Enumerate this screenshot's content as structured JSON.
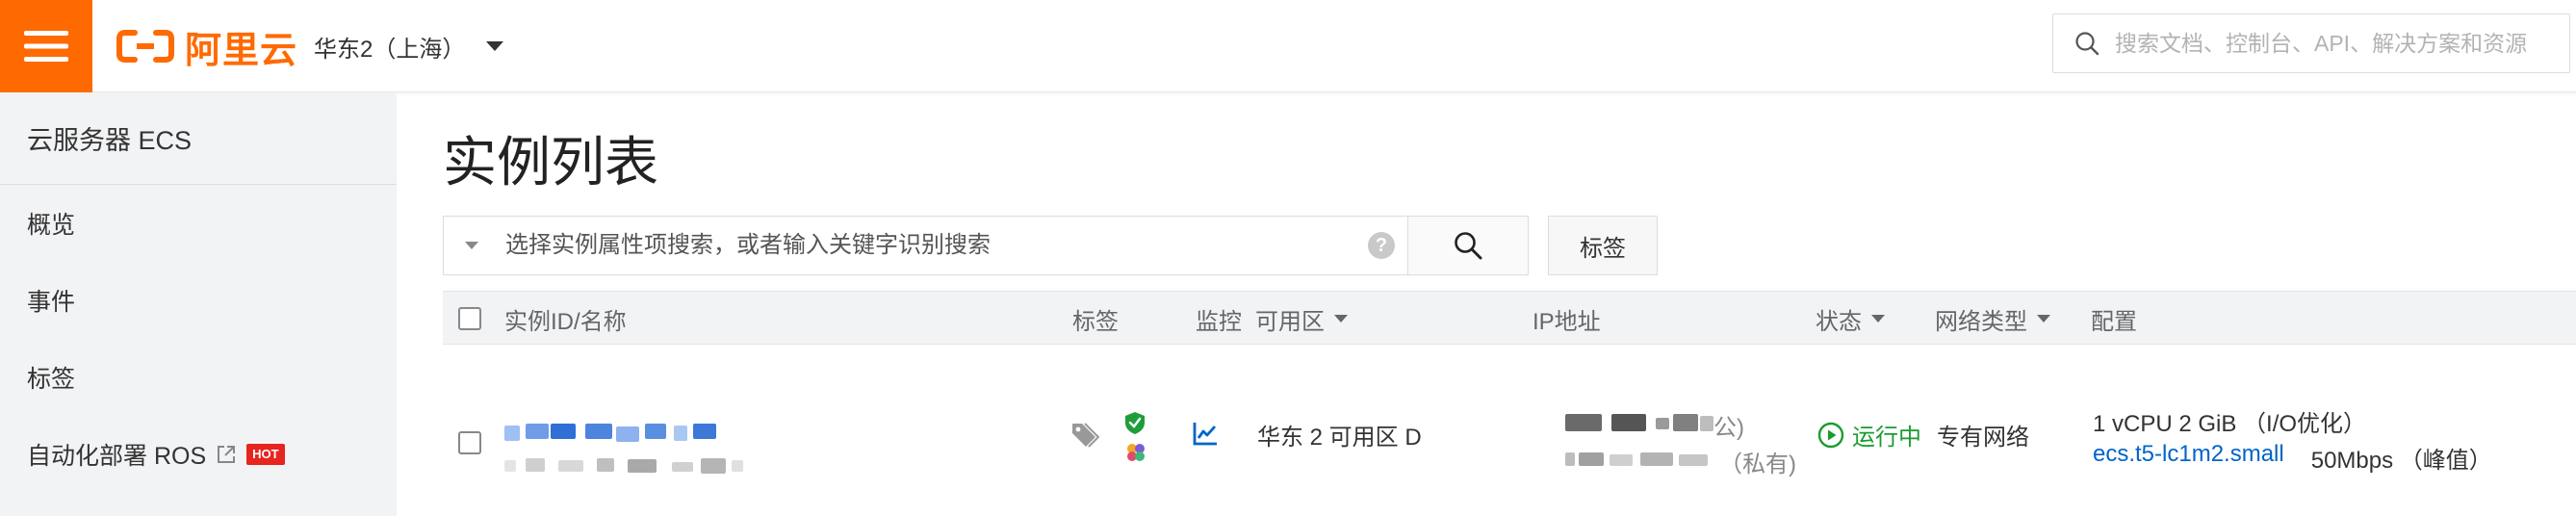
{
  "topbar": {
    "logo_text": "阿里云",
    "region": "华东2（上海）",
    "search_placeholder": "搜索文档、控制台、API、解决方案和资源"
  },
  "sidebar": {
    "title": "云服务器 ECS",
    "items": [
      {
        "label": "概览"
      },
      {
        "label": "事件"
      },
      {
        "label": "标签"
      },
      {
        "label": "自动化部署 ROS",
        "badge": "HOT"
      }
    ]
  },
  "main": {
    "title": "实例列表",
    "filter_placeholder": "选择实例属性项搜索，或者输入关键字识别搜索",
    "help": "?",
    "tag_button": "标签",
    "columns": {
      "id_name": "实例ID/名称",
      "tags": "标签",
      "monitor": "监控",
      "zone": "可用区",
      "ip": "IP地址",
      "status": "状态",
      "network": "网络类型",
      "config": "配置"
    },
    "row": {
      "zone": "华东 2 可用区 D",
      "ip_public_suffix": "公)",
      "ip_private_suffix": "（私有)",
      "status": "运行中",
      "network": "专有网络",
      "config_line1": "1 vCPU 2 GiB （I/O优化）",
      "instance_type": "ecs.t5-lc1m2.small",
      "bandwidth": "50Mbps （峰值）"
    }
  },
  "colors": {
    "brand": "#ff6a00",
    "link": "#0064c8",
    "running": "#1a9c2f",
    "hot": "#e6251f"
  }
}
